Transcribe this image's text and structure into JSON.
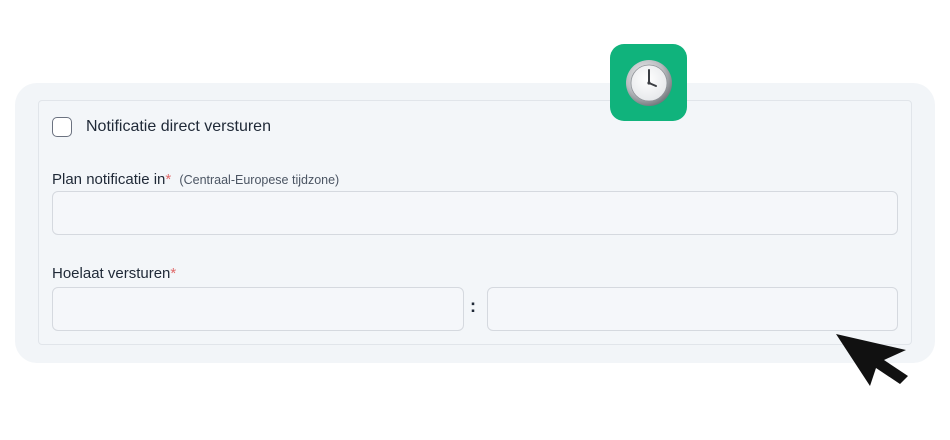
{
  "form": {
    "send_now_label": "Notificatie direct versturen",
    "send_now_checked": false,
    "schedule_label": "Plan notificatie in",
    "schedule_required_mark": "*",
    "schedule_hint": "(Centraal-Europese tijdzone)",
    "schedule_value": "",
    "time_label": "Hoelaat versturen",
    "time_required_mark": "*",
    "time_separator": ":",
    "hour_value": "",
    "minute_value": ""
  },
  "icons": {
    "badge": "clock-icon",
    "pointer": "mouse-cursor-icon"
  },
  "colors": {
    "badge_bg": "#10b37c",
    "required": "#e06a6a",
    "card_bg": "#f2f5f8"
  }
}
